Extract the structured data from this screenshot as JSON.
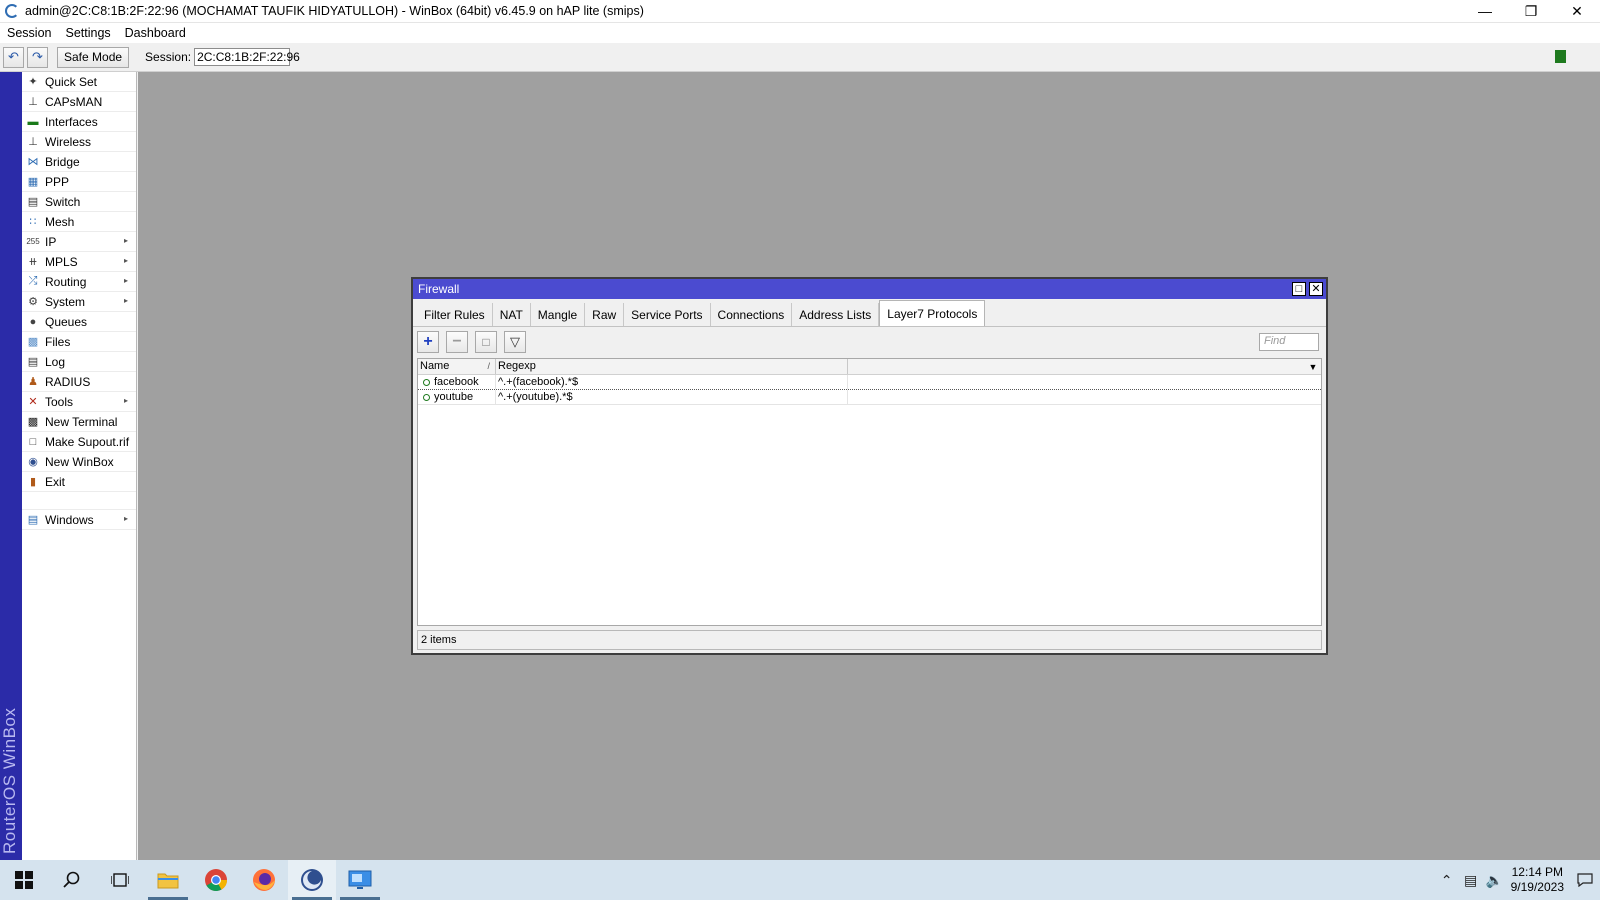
{
  "window": {
    "title": "admin@2C:C8:1B:2F:22:96 (MOCHAMAT TAUFIK HIDYATULLOH) - WinBox (64bit) v6.45.9 on hAP lite (smips)",
    "minimize_icon": "minimize-icon",
    "maximize_icon": "restore-icon",
    "close_icon": "close-icon"
  },
  "menubar": {
    "items": [
      "Session",
      "Settings",
      "Dashboard"
    ]
  },
  "toolbar": {
    "undo_icon": "undo-icon",
    "redo_icon": "redo-icon",
    "safe_mode_label": "Safe Mode",
    "session_label": "Session:",
    "session_value": "2C:C8:1B:2F:22:96",
    "status_color": "#1f7a1f"
  },
  "brand": {
    "vertical_text": "RouterOS WinBox",
    "color": "#2b2ba8"
  },
  "sidebar": {
    "items": [
      {
        "label": "Quick Set",
        "icon": "quick-set-icon",
        "submenu": false
      },
      {
        "label": "CAPsMAN",
        "icon": "capsman-icon",
        "submenu": false
      },
      {
        "label": "Interfaces",
        "icon": "interfaces-icon",
        "submenu": false
      },
      {
        "label": "Wireless",
        "icon": "wireless-icon",
        "submenu": false
      },
      {
        "label": "Bridge",
        "icon": "bridge-icon",
        "submenu": false
      },
      {
        "label": "PPP",
        "icon": "ppp-icon",
        "submenu": false
      },
      {
        "label": "Switch",
        "icon": "switch-icon",
        "submenu": false
      },
      {
        "label": "Mesh",
        "icon": "mesh-icon",
        "submenu": false
      },
      {
        "label": "IP",
        "icon": "ip-icon",
        "submenu": true
      },
      {
        "label": "MPLS",
        "icon": "mpls-icon",
        "submenu": true
      },
      {
        "label": "Routing",
        "icon": "routing-icon",
        "submenu": true
      },
      {
        "label": "System",
        "icon": "system-icon",
        "submenu": true
      },
      {
        "label": "Queues",
        "icon": "queues-icon",
        "submenu": false
      },
      {
        "label": "Files",
        "icon": "files-icon",
        "submenu": false
      },
      {
        "label": "Log",
        "icon": "log-icon",
        "submenu": false
      },
      {
        "label": "RADIUS",
        "icon": "radius-icon",
        "submenu": false
      },
      {
        "label": "Tools",
        "icon": "tools-icon",
        "submenu": true
      },
      {
        "label": "New Terminal",
        "icon": "terminal-icon",
        "submenu": false
      },
      {
        "label": "Make Supout.rif",
        "icon": "supout-icon",
        "submenu": false
      },
      {
        "label": "New WinBox",
        "icon": "winbox-icon",
        "submenu": false
      },
      {
        "label": "Exit",
        "icon": "exit-icon",
        "submenu": false
      }
    ],
    "windows_item": {
      "label": "Windows",
      "icon": "windows-icon",
      "submenu": true
    }
  },
  "firewall": {
    "title": "Firewall",
    "tabs": [
      "Filter Rules",
      "NAT",
      "Mangle",
      "Raw",
      "Service Ports",
      "Connections",
      "Address Lists",
      "Layer7 Protocols"
    ],
    "active_tab": "Layer7 Protocols",
    "find_placeholder": "Find",
    "columns": [
      "Name",
      "Regexp"
    ],
    "rows": [
      {
        "name": "facebook",
        "regexp": "^.+(facebook).*$"
      },
      {
        "name": "youtube",
        "regexp": "^.+(youtube).*$"
      }
    ],
    "status": "2 items"
  },
  "taskbar": {
    "apps": [
      "start-icon",
      "search-icon",
      "task-view-icon",
      "file-explorer-icon",
      "chrome-icon",
      "firefox-icon",
      "winbox-icon",
      "remote-desktop-icon"
    ],
    "clock_time": "12:14 PM",
    "clock_date": "9/19/2023"
  }
}
